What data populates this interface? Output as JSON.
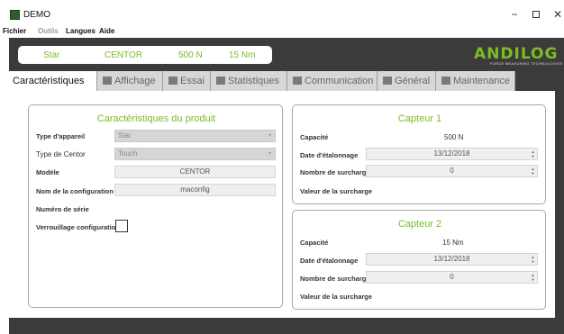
{
  "window": {
    "title": "DEMO",
    "minimize": "−",
    "close": "✕"
  },
  "menu": [
    "Fichier",
    "Outils",
    "Langues",
    "Aide"
  ],
  "header": {
    "model": "Star",
    "series": "CENTOR",
    "capacity_1": "500 N",
    "capacity_2": "15 Nm"
  },
  "logo": {
    "name": "ANDILOG",
    "tagline": "FORCE MEASURING TECHNOLOGIES"
  },
  "tabs": [
    {
      "label": "Caractéristiques",
      "icon": "none",
      "active": true
    },
    {
      "label": "Affichage",
      "icon": "display-icon"
    },
    {
      "label": "Essai",
      "icon": "test-icon"
    },
    {
      "label": "Statistiques",
      "icon": "statistics-icon"
    },
    {
      "label": "Communication",
      "icon": "communication-icon"
    },
    {
      "label": "Général",
      "icon": "general-icon"
    },
    {
      "label": "Maintenance",
      "icon": "maintenance-icon"
    }
  ],
  "product": {
    "title": "Caractéristiques du produit",
    "device_type_label": "Type d'appareil",
    "device_type_value": "Star",
    "centor_type_label": "Type de Centor",
    "centor_type_value": "Touch",
    "model_label": "Modèle",
    "model_value": "CENTOR",
    "config_name_label": "Nom de la configuration",
    "config_name_value": "maconfig",
    "serial_label": "Numéro de série",
    "lock_label": "Verrouillage configuration"
  },
  "sensor1": {
    "title": "Capteur 1",
    "capacity_label": "Capacité",
    "capacity_value": "500 N",
    "calib_label": "Date d'étalonnage",
    "calib_value": "13/12/2018",
    "overload_label": "Nombre de surcharges",
    "overload_value": "0",
    "overload_val_label": "Valeur de la surcharge"
  },
  "sensor2": {
    "title": "Capteur 2",
    "capacity_label": "Capacité",
    "capacity_value": "15 Nm",
    "calib_label": "Date d'étalonnage",
    "calib_value": "13/12/2018",
    "overload_label": "Nombre de surcharges",
    "overload_value": "0",
    "overload_val_label": "Valeur de la surcharge"
  },
  "colors": {
    "accent": "#7bbd24",
    "dark_bg": "#3b3b3b",
    "tab_bg": "#d7d7d7"
  }
}
